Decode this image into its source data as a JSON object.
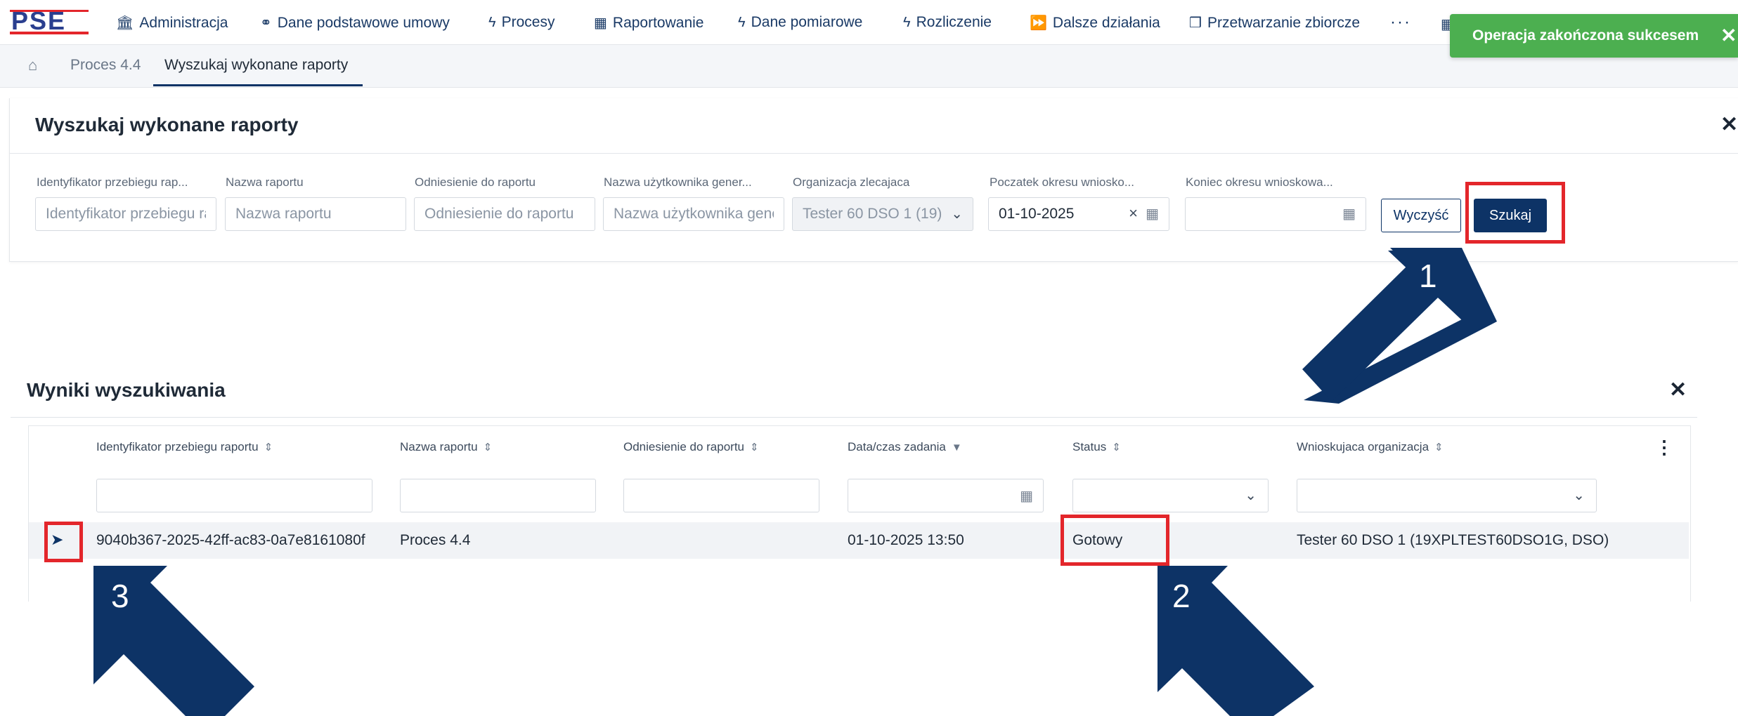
{
  "nav": {
    "items": [
      {
        "label": "Administracja",
        "icon": "bank-icon"
      },
      {
        "label": "Dane podstawowe umowy",
        "icon": "handshake-icon"
      },
      {
        "label": "Procesy",
        "icon": "bolt-icon"
      },
      {
        "label": "Raportowanie",
        "icon": "table-icon"
      },
      {
        "label": "Dane pomiarowe",
        "icon": "bolt-icon"
      },
      {
        "label": "Rozliczenie",
        "icon": "bolt-icon"
      },
      {
        "label": "Dalsze działania",
        "icon": "fast-forward-icon"
      },
      {
        "label": "Przetwarzanie zbiorcze",
        "icon": "cube-icon"
      }
    ],
    "more": "···"
  },
  "breadcrumb": {
    "items": [
      "Proces 4.4",
      "Wyszukaj wykonane raporty"
    ]
  },
  "toast": {
    "text": "Operacja zakończona sukcesem",
    "color": "#4caf50"
  },
  "search": {
    "title": "Wyszukaj wykonane raporty",
    "fields": [
      {
        "label": "Identyfikator przebiegu rap...",
        "placeholder": "Identyfikator przebiegu raportu"
      },
      {
        "label": "Nazwa raportu",
        "placeholder": "Nazwa raportu"
      },
      {
        "label": "Odniesienie do raportu",
        "placeholder": "Odniesienie do raportu"
      },
      {
        "label": "Nazwa użytkownika gener...",
        "placeholder": "Nazwa użytkownika generującego"
      },
      {
        "label": "Organizacja zlecajaca",
        "value": "Tester 60 DSO 1 (19)"
      },
      {
        "label": "Poczatek okresu wniosko...",
        "value": "01-10-2025"
      },
      {
        "label": "Koniec okresu wnioskowa...",
        "value": ""
      }
    ],
    "clear_label": "Wyczyść",
    "search_label": "Szukaj"
  },
  "results": {
    "title": "Wyniki wyszukiwania",
    "columns": [
      {
        "label": "Identyfikator przebiegu raportu",
        "sort": "⇕"
      },
      {
        "label": "Nazwa raportu",
        "sort": "⇕"
      },
      {
        "label": "Odniesienie do raportu",
        "sort": "⇕"
      },
      {
        "label": "Data/czas zadania",
        "sort": "▼"
      },
      {
        "label": "Status",
        "sort": "⇕"
      },
      {
        "label": "Wnioskujaca organizacja",
        "sort": "⇕"
      }
    ],
    "rows": [
      {
        "id": "9040b367-2025-42ff-ac83-0a7e8161080f",
        "name": "Proces 4.4",
        "reference": "",
        "datetime": "01-10-2025 13:50",
        "status": "Gotowy",
        "organization": "Tester 60 DSO 1 (19XPLTEST60DSO1G, DSO)"
      }
    ]
  },
  "annotations": {
    "labels": [
      "1",
      "2",
      "3"
    ],
    "arrow_color": "#0d3366",
    "box_color": "#e3262b"
  }
}
